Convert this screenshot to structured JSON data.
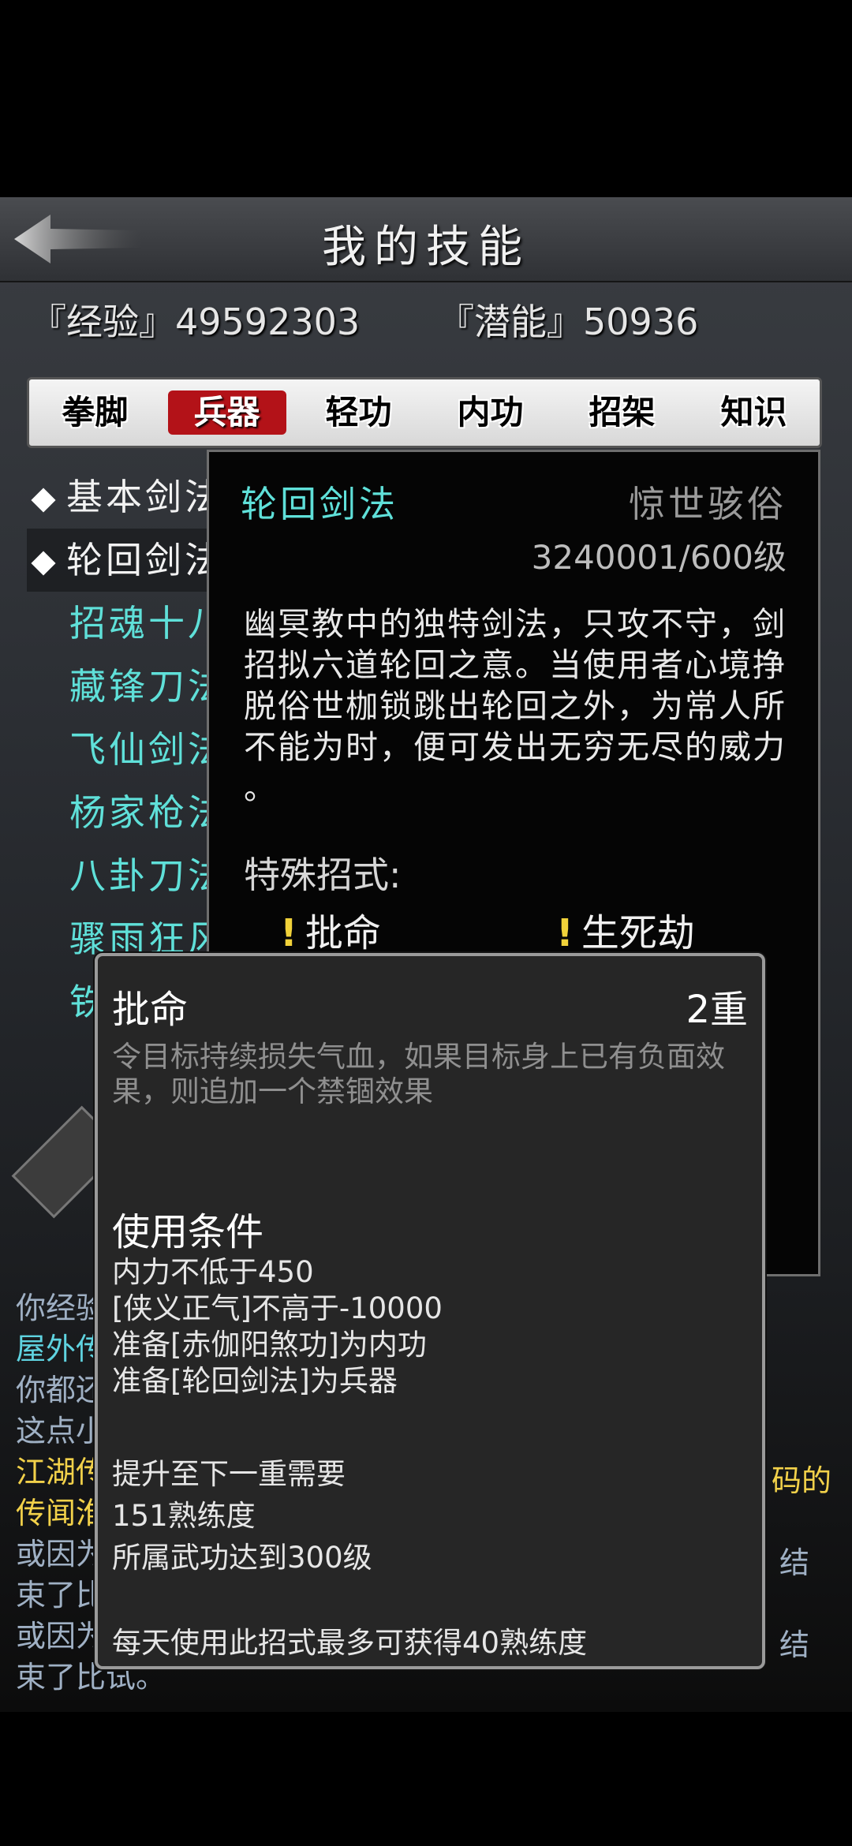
{
  "header": {
    "title": "我的技能"
  },
  "stats": {
    "experience": "『经验』49592303",
    "potential": "『潜能』50936"
  },
  "tabs": [
    {
      "label": "拳脚"
    },
    {
      "label": "兵器"
    },
    {
      "label": "轻功"
    },
    {
      "label": "内功"
    },
    {
      "label": "招架"
    },
    {
      "label": "知识"
    }
  ],
  "active_tab": "兵器",
  "skill_list": [
    {
      "label": "基本剑法"
    },
    {
      "label": "轮回剑法"
    },
    {
      "label": "招魂十八"
    },
    {
      "label": "藏锋刀法"
    },
    {
      "label": "飞仙剑法"
    },
    {
      "label": "杨家枪法"
    },
    {
      "label": "八卦刀法"
    },
    {
      "label": "骤雨狂风"
    },
    {
      "label": "铁"
    }
  ],
  "detail": {
    "name": "轮回剑法",
    "rank": "惊世骇俗",
    "level": "3240001/600级",
    "desc_lines": [
      "幽冥教中的独特剑法，只攻不守，剑",
      "招拟六道轮回之意。当使用者心境挣",
      "脱俗世枷锁跳出轮回之外，为常人所",
      "不能为时，便可发出无穷无尽的威力",
      "。"
    ],
    "special_label": "特殊招式:",
    "moves": [
      {
        "bang": "!",
        "name": "批命"
      },
      {
        "bang": "!",
        "name": "生死劫"
      }
    ]
  },
  "log": {
    "lines": [
      {
        "text": "你经验",
        "color": "gray"
      },
      {
        "text": "屋外传",
        "color": "cyan"
      },
      {
        "text": "你都还",
        "color": "gray"
      },
      {
        "text": "这点小",
        "color": "gray"
      },
      {
        "text": "江湖传",
        "color": "yellow"
      },
      {
        "text": "传闻淮",
        "color": "yellow"
      },
      {
        "text": "或因为",
        "color": "gray"
      },
      {
        "text": "束了比",
        "color": "gray"
      },
      {
        "text": "或因为",
        "color": "gray"
      },
      {
        "text": "束了比试。",
        "color": "gray"
      }
    ],
    "right_fragments": [
      {
        "text": "码的"
      },
      {
        "text": "结"
      },
      {
        "text": "结"
      }
    ]
  },
  "tooltip": {
    "name": "批命",
    "level": "2重",
    "desc_lines": [
      "令目标持续损失气血，如果目标身上已有负面效",
      "果，则追加一个禁锢效果"
    ],
    "cond_title": "使用条件",
    "conditions": [
      "内力不低于450",
      "[侠义正气]不高于-10000",
      "准备[赤伽阳煞功]为内功",
      "准备[轮回剑法]为兵器"
    ],
    "upgrade_lines": [
      "提升至下一重需要",
      "151熟练度",
      "所属武功达到300级"
    ],
    "daily": "每天使用此招式最多可获得40熟练度"
  },
  "colors": {
    "accent_red": "#b31218",
    "cyan_text": "#5fe0d9",
    "yellow_text": "#f2d14a"
  }
}
